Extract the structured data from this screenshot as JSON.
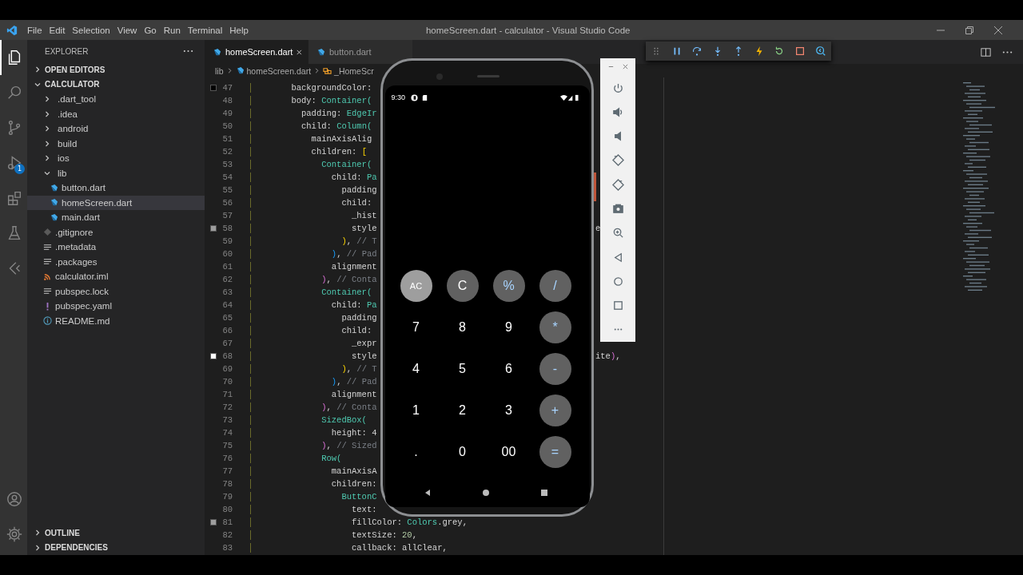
{
  "window": {
    "title": "homeScreen.dart - calculator - Visual Studio Code"
  },
  "menu": [
    "File",
    "Edit",
    "Selection",
    "View",
    "Go",
    "Run",
    "Terminal",
    "Help"
  ],
  "activity_bar": {
    "items": [
      {
        "kind": "files",
        "selected": true
      },
      {
        "kind": "search",
        "selected": false
      },
      {
        "kind": "source-control",
        "selected": false
      },
      {
        "kind": "run-debug",
        "selected": false,
        "badge": "1"
      },
      {
        "kind": "extensions",
        "selected": false
      },
      {
        "kind": "testing",
        "selected": false
      },
      {
        "kind": "flutter",
        "selected": false
      }
    ],
    "bottom": [
      {
        "kind": "account"
      },
      {
        "kind": "settings"
      }
    ]
  },
  "sidebar": {
    "title": "EXPLORER",
    "sections": [
      {
        "label": "OPEN EDITORS",
        "expanded": false
      },
      {
        "label": "CALCULATOR",
        "expanded": true,
        "items": [
          {
            "label": ".dart_tool",
            "kind": "folder",
            "expanded": false,
            "selected": false
          },
          {
            "label": ".idea",
            "kind": "folder",
            "expanded": false,
            "selected": false
          },
          {
            "label": "android",
            "kind": "folder",
            "expanded": false,
            "selected": false
          },
          {
            "label": "build",
            "kind": "folder",
            "expanded": false,
            "selected": false
          },
          {
            "label": "ios",
            "kind": "folder",
            "expanded": false,
            "selected": false
          },
          {
            "label": "lib",
            "kind": "folder",
            "expanded": true,
            "selected": false,
            "children": [
              {
                "label": "button.dart",
                "kind": "dart",
                "selected": false
              },
              {
                "label": "homeScreen.dart",
                "kind": "dart",
                "selected": true
              },
              {
                "label": "main.dart",
                "kind": "dart",
                "selected": false
              }
            ]
          },
          {
            "label": ".gitignore",
            "kind": "git",
            "selected": false
          },
          {
            "label": ".metadata",
            "kind": "lines",
            "selected": false
          },
          {
            "label": ".packages",
            "kind": "lines",
            "selected": false
          },
          {
            "label": "calculator.iml",
            "kind": "feed",
            "selected": false
          },
          {
            "label": "pubspec.lock",
            "kind": "lines",
            "selected": false
          },
          {
            "label": "pubspec.yaml",
            "kind": "yaml",
            "selected": false
          },
          {
            "label": "README.md",
            "kind": "info",
            "selected": false
          }
        ]
      },
      {
        "label": "OUTLINE",
        "expanded": false
      },
      {
        "label": "DEPENDENCIES",
        "expanded": false
      }
    ]
  },
  "tabs": [
    {
      "label": "homeScreen.dart",
      "selected": true
    },
    {
      "label": "button.dart",
      "selected": false
    }
  ],
  "breadcrumb": [
    {
      "label": "lib",
      "kind": "folder"
    },
    {
      "label": "homeScreen.dart",
      "kind": "dart"
    },
    {
      "label": "_HomeScr",
      "kind": "class"
    }
  ],
  "debug_toolbar": [
    {
      "kind": "grip"
    },
    {
      "kind": "pause"
    },
    {
      "kind": "step-over"
    },
    {
      "kind": "step-into"
    },
    {
      "kind": "step-out"
    },
    {
      "kind": "hot-reload"
    },
    {
      "kind": "restart"
    },
    {
      "kind": "stop"
    },
    {
      "kind": "devtools"
    }
  ],
  "editor": {
    "lines": [
      {
        "number": "47",
        "color": "#000000",
        "segments": [
          {
            "text": "        backgroundColor:",
            "kind": "plain"
          }
        ]
      },
      {
        "number": "48",
        "segments": [
          {
            "text": "        body: ",
            "kind": "plain"
          },
          {
            "text": "Container(",
            "kind": "class"
          }
        ]
      },
      {
        "number": "49",
        "segments": [
          {
            "text": "          padding: ",
            "kind": "plain"
          },
          {
            "text": "EdgeIr",
            "kind": "class"
          }
        ]
      },
      {
        "number": "50",
        "segments": [
          {
            "text": "          child: ",
            "kind": "plain"
          },
          {
            "text": "Column(",
            "kind": "class"
          }
        ]
      },
      {
        "number": "51",
        "segments": [
          {
            "text": "            mainAxisAlig",
            "kind": "plain"
          }
        ]
      },
      {
        "number": "52",
        "segments": [
          {
            "text": "            children: ",
            "kind": "plain"
          },
          {
            "text": "[",
            "kind": "bracket1"
          }
        ]
      },
      {
        "number": "53",
        "segments": [
          {
            "text": "              Container(",
            "kind": "class"
          }
        ]
      },
      {
        "number": "54",
        "segments": [
          {
            "text": "                child: ",
            "kind": "plain"
          },
          {
            "text": "Pa",
            "kind": "class"
          }
        ]
      },
      {
        "number": "55",
        "segments": [
          {
            "text": "                  padding",
            "kind": "plain"
          }
        ]
      },
      {
        "number": "56",
        "segments": [
          {
            "text": "                  child:",
            "kind": "plain"
          }
        ]
      },
      {
        "number": "57",
        "segments": [
          {
            "text": "                    _hist",
            "kind": "plain"
          }
        ]
      },
      {
        "number": "58",
        "color": "#9e9e9e",
        "segments": [
          {
            "text": "                    style",
            "kind": "plain"
          }
        ],
        "tail": [
          {
            "text": "e",
            "kind": "plain"
          }
        ]
      },
      {
        "number": "59",
        "segments": [
          {
            "text": "                  )",
            "kind": "bracket1"
          },
          {
            "text": ", ",
            "kind": "plain"
          },
          {
            "text": "// T",
            "kind": "comment"
          }
        ]
      },
      {
        "number": "60",
        "segments": [
          {
            "text": "                )",
            "kind": "bracket2"
          },
          {
            "text": ", ",
            "kind": "plain"
          },
          {
            "text": "// Pad",
            "kind": "comment"
          }
        ]
      },
      {
        "number": "61",
        "segments": [
          {
            "text": "                alignment",
            "kind": "plain"
          }
        ]
      },
      {
        "number": "62",
        "segments": [
          {
            "text": "              )",
            "kind": "bracket3"
          },
          {
            "text": ", ",
            "kind": "plain"
          },
          {
            "text": "// Conta",
            "kind": "comment"
          }
        ]
      },
      {
        "number": "63",
        "segments": [
          {
            "text": "              Container(",
            "kind": "class"
          }
        ]
      },
      {
        "number": "64",
        "segments": [
          {
            "text": "                child: ",
            "kind": "plain"
          },
          {
            "text": "Pa",
            "kind": "class"
          }
        ]
      },
      {
        "number": "65",
        "segments": [
          {
            "text": "                  padding",
            "kind": "plain"
          }
        ]
      },
      {
        "number": "66",
        "segments": [
          {
            "text": "                  child:",
            "kind": "plain"
          }
        ]
      },
      {
        "number": "67",
        "segments": [
          {
            "text": "                    _expr",
            "kind": "plain"
          }
        ]
      },
      {
        "number": "68",
        "color": "#ffffff",
        "segments": [
          {
            "text": "                    style",
            "kind": "plain"
          }
        ],
        "tail": [
          {
            "text": "ite",
            "kind": "plain"
          },
          {
            "text": ")",
            "kind": "bracket3"
          },
          {
            "text": ",",
            "kind": "plain"
          }
        ]
      },
      {
        "number": "69",
        "segments": [
          {
            "text": "                  )",
            "kind": "bracket1"
          },
          {
            "text": ", ",
            "kind": "plain"
          },
          {
            "text": "// T",
            "kind": "comment"
          }
        ]
      },
      {
        "number": "70",
        "segments": [
          {
            "text": "                )",
            "kind": "bracket2"
          },
          {
            "text": ", ",
            "kind": "plain"
          },
          {
            "text": "// Pad",
            "kind": "comment"
          }
        ]
      },
      {
        "number": "71",
        "segments": [
          {
            "text": "                alignment",
            "kind": "plain"
          }
        ]
      },
      {
        "number": "72",
        "segments": [
          {
            "text": "              )",
            "kind": "bracket3"
          },
          {
            "text": ", ",
            "kind": "plain"
          },
          {
            "text": "// Conta",
            "kind": "comment"
          }
        ]
      },
      {
        "number": "73",
        "segments": [
          {
            "text": "              SizedBox(",
            "kind": "class"
          }
        ]
      },
      {
        "number": "74",
        "segments": [
          {
            "text": "                height: 4",
            "kind": "plain"
          }
        ]
      },
      {
        "number": "75",
        "segments": [
          {
            "text": "              )",
            "kind": "bracket3"
          },
          {
            "text": ", ",
            "kind": "plain"
          },
          {
            "text": "// Sized",
            "kind": "comment"
          }
        ]
      },
      {
        "number": "76",
        "segments": [
          {
            "text": "              Row(",
            "kind": "class"
          }
        ]
      },
      {
        "number": "77",
        "segments": [
          {
            "text": "                mainAxisA",
            "kind": "plain"
          }
        ]
      },
      {
        "number": "78",
        "segments": [
          {
            "text": "                children:",
            "kind": "plain"
          }
        ]
      },
      {
        "number": "79",
        "segments": [
          {
            "text": "                  ButtonC",
            "kind": "class"
          }
        ]
      },
      {
        "number": "80",
        "segments": [
          {
            "text": "                    text:",
            "kind": "plain"
          }
        ]
      },
      {
        "number": "81",
        "color": "#9e9e9e",
        "segments": [
          {
            "text": "                    fillColor: ",
            "kind": "plain"
          },
          {
            "text": "Colors",
            "kind": "class"
          },
          {
            "text": ".grey,",
            "kind": "plain"
          }
        ]
      },
      {
        "number": "82",
        "segments": [
          {
            "text": "                    textSize: ",
            "kind": "plain"
          },
          {
            "text": "20",
            "kind": "number"
          },
          {
            "text": ",",
            "kind": "plain"
          }
        ]
      },
      {
        "number": "83",
        "segments": [
          {
            "text": "                    callback: allClear,",
            "kind": "plain"
          }
        ]
      }
    ]
  },
  "emulator": {
    "time": "9:30",
    "keys": [
      {
        "label": "AC",
        "kind": "clear"
      },
      {
        "label": "C",
        "kind": "function"
      },
      {
        "label": "%",
        "kind": "operator"
      },
      {
        "label": "/",
        "kind": "operator"
      },
      {
        "label": "7",
        "kind": "digit"
      },
      {
        "label": "8",
        "kind": "digit"
      },
      {
        "label": "9",
        "kind": "digit"
      },
      {
        "label": "*",
        "kind": "operator"
      },
      {
        "label": "4",
        "kind": "digit"
      },
      {
        "label": "5",
        "kind": "digit"
      },
      {
        "label": "6",
        "kind": "digit"
      },
      {
        "label": "-",
        "kind": "operator"
      },
      {
        "label": "1",
        "kind": "digit"
      },
      {
        "label": "2",
        "kind": "digit"
      },
      {
        "label": "3",
        "kind": "digit"
      },
      {
        "label": "+",
        "kind": "operator"
      },
      {
        "label": ".",
        "kind": "digit"
      },
      {
        "label": "0",
        "kind": "digit"
      },
      {
        "label": "00",
        "kind": "digit"
      },
      {
        "label": "=",
        "kind": "operator"
      }
    ]
  },
  "emulator_toolbar": [
    {
      "kind": "power"
    },
    {
      "kind": "volume-up"
    },
    {
      "kind": "volume-down"
    },
    {
      "kind": "rotate-left"
    },
    {
      "kind": "rotate-right"
    },
    {
      "kind": "camera"
    },
    {
      "kind": "zoom"
    },
    {
      "kind": "back"
    },
    {
      "kind": "home"
    },
    {
      "kind": "overview"
    },
    {
      "kind": "more"
    }
  ]
}
